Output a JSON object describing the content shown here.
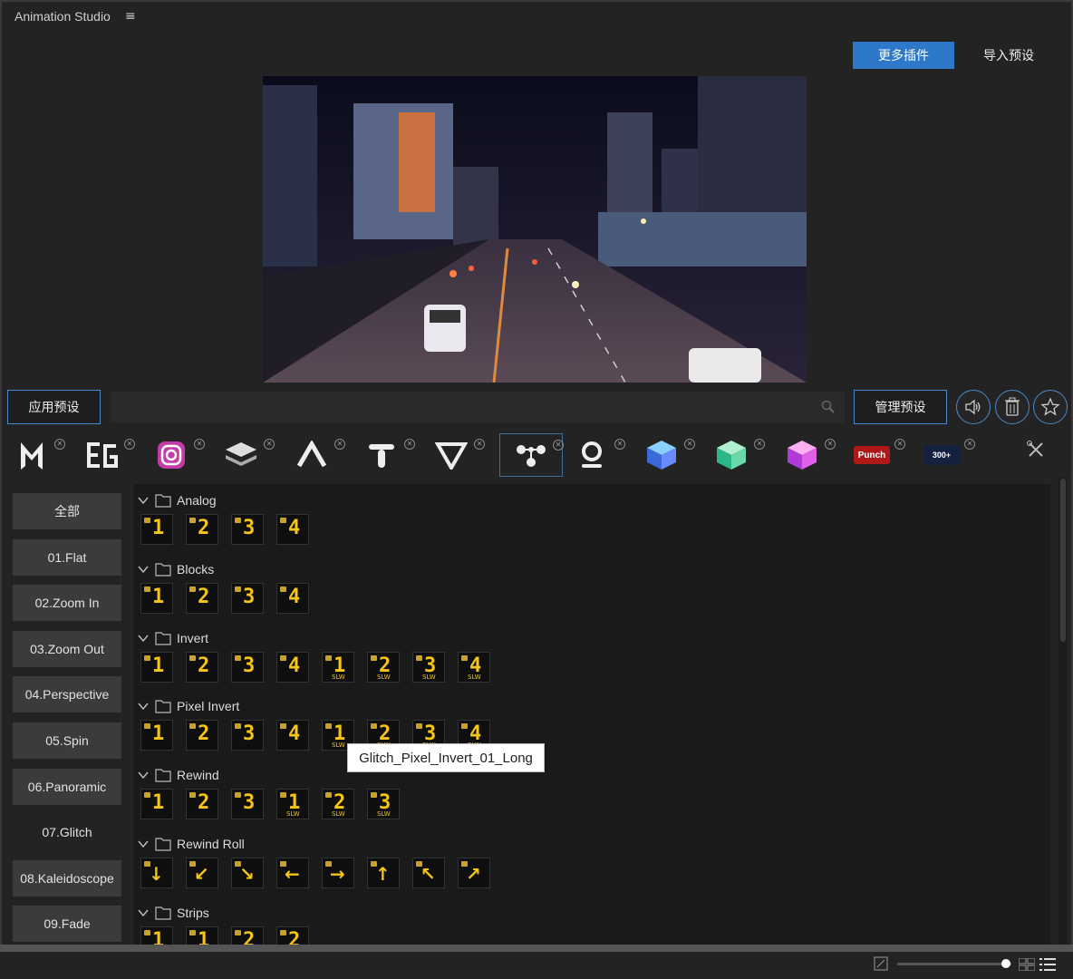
{
  "app": {
    "title": "Animation Studio"
  },
  "header": {
    "more_plugins": "更多插件",
    "import_preset": "导入预设"
  },
  "toolbar": {
    "apply_preset": "应用预设",
    "search_placeholder": "",
    "manage_preset": "管理预设"
  },
  "plugin_tabs": [
    {
      "icon": "m-logo-icon"
    },
    {
      "icon": "eg-logo-icon"
    },
    {
      "icon": "instagram-icon"
    },
    {
      "icon": "layers-icon"
    },
    {
      "icon": "a-logo-icon"
    },
    {
      "icon": "t-logo-icon"
    },
    {
      "icon": "v-logo-icon"
    },
    {
      "icon": "nodes-logo-icon",
      "active": true
    },
    {
      "icon": "o-logo-icon"
    },
    {
      "icon": "blue-cube-icon"
    },
    {
      "icon": "green-cube-icon"
    },
    {
      "icon": "pink-cube-icon"
    },
    {
      "icon": "punch-logo-icon",
      "text": "Punch"
    },
    {
      "icon": "transitions-logo-icon",
      "text": "300+"
    }
  ],
  "categories": [
    "全部",
    "01.Flat",
    "02.Zoom In",
    "03.Zoom Out",
    "04.Perspective",
    "05.Spin",
    "06.Panoramic",
    "07.Glitch",
    "08.Kaleidoscope",
    "09.Fade"
  ],
  "active_category": "07.Glitch",
  "groups": [
    {
      "name": "Analog",
      "items": [
        "1",
        "2",
        "3",
        "4"
      ]
    },
    {
      "name": "Blocks",
      "items": [
        "1",
        "2",
        "3",
        "4"
      ]
    },
    {
      "name": "Invert",
      "items": [
        "1",
        "2",
        "3",
        "4",
        "1s",
        "2s",
        "3s",
        "4s"
      ]
    },
    {
      "name": "Pixel Invert",
      "items": [
        "1",
        "2",
        "3",
        "4",
        "1s",
        "2s",
        "3s",
        "4s"
      ]
    },
    {
      "name": "Rewind",
      "items": [
        "1",
        "2",
        "3",
        "1s",
        "2s",
        "3s"
      ]
    },
    {
      "name": "Rewind Roll",
      "items": [
        "↓",
        "↙",
        "↘",
        "←",
        "→",
        "↑",
        "↖",
        "↗"
      ]
    },
    {
      "name": "Strips",
      "items": [
        "1",
        "1",
        "2",
        "2"
      ]
    }
  ],
  "slw_label": "SLW",
  "tooltip": "Glitch_Pixel_Invert_01_Long",
  "colors": {
    "accent": "#2d78c9",
    "thumb_yellow": "#f5c518"
  }
}
